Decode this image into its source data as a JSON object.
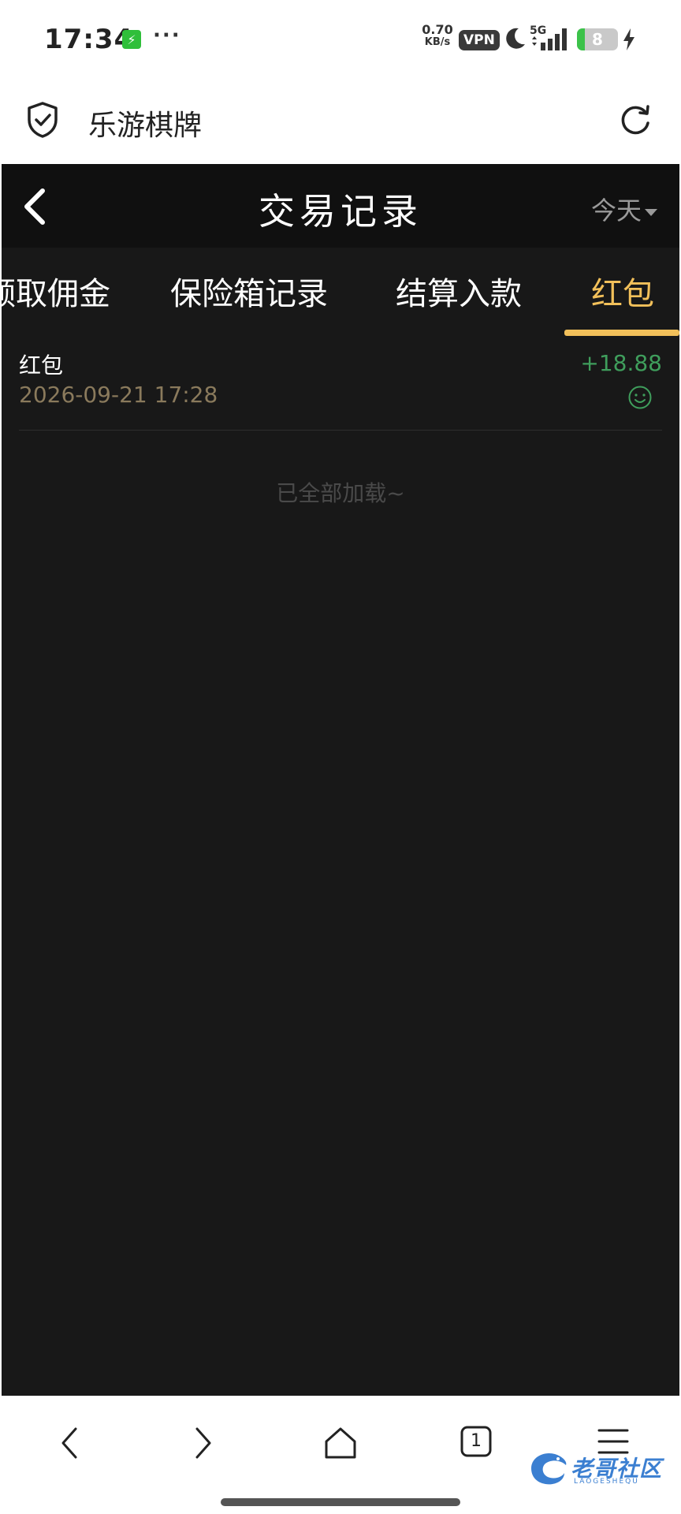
{
  "status_bar": {
    "time": "17:34",
    "more": "···",
    "net_speed_value": "0.70",
    "net_speed_unit": "KB/s",
    "vpn": "VPN",
    "network": "5G",
    "battery_level": "8",
    "battery_fraction": 0.08
  },
  "browser": {
    "page_title": "乐游棋牌",
    "tab_count": "1"
  },
  "app": {
    "title": "交易记录",
    "filter_label": "今天",
    "tabs": [
      {
        "label": "领取佣金"
      },
      {
        "label": "保险箱记录"
      },
      {
        "label": "结算入款"
      },
      {
        "label": "红包"
      }
    ],
    "active_tab": 3,
    "records": [
      {
        "title": "红包",
        "time": "2026-09-21 17:28",
        "amount": "+18.88"
      }
    ],
    "loaded_text": "已全部加载~",
    "colors": {
      "background": "#181818",
      "navbar": "#101010",
      "accent": "#f2c05a",
      "amount_positive": "#3f9e5c",
      "time_text": "#8a7a5c"
    }
  },
  "watermark": {
    "text": "老哥社区",
    "sub": "LAOGESHEQU"
  }
}
